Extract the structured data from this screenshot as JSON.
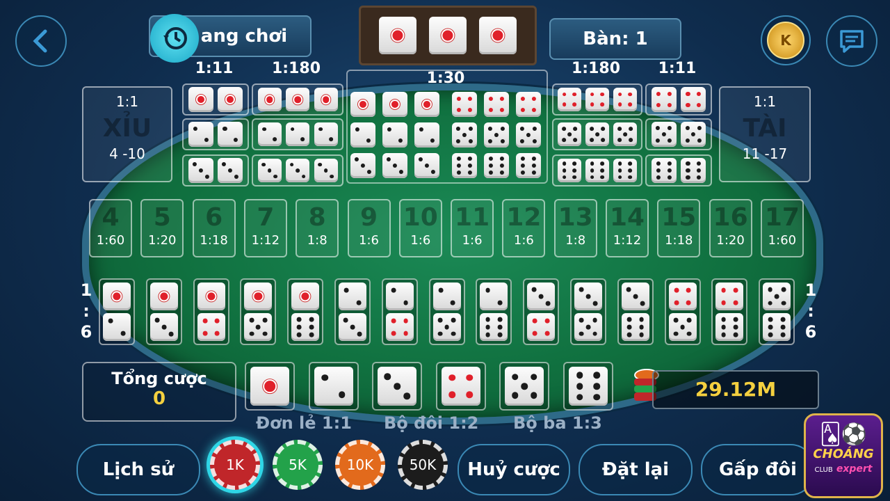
{
  "header": {
    "history_label": "ang chơi",
    "table_label": "Bàn: 1"
  },
  "rolled_dice": [
    1,
    1,
    1
  ],
  "triple_rows": {
    "left_pair_ratio": "1:11",
    "left_triple_ratio": "1:180",
    "any_triple_ratio": "1:30",
    "right_triple_ratio": "1:180",
    "right_pair_ratio": "1:11"
  },
  "small": {
    "ratio": "1:1",
    "name": "XỈU",
    "range": "4 -10"
  },
  "big": {
    "ratio": "1:1",
    "name": "TÀI",
    "range": "11 -17"
  },
  "sums": [
    {
      "n": "4",
      "p": "1:60"
    },
    {
      "n": "5",
      "p": "1:20"
    },
    {
      "n": "6",
      "p": "1:18"
    },
    {
      "n": "7",
      "p": "1:12"
    },
    {
      "n": "8",
      "p": "1:8"
    },
    {
      "n": "9",
      "p": "1:6"
    },
    {
      "n": "10",
      "p": "1:6"
    },
    {
      "n": "11",
      "p": "1:6"
    },
    {
      "n": "12",
      "p": "1:6"
    },
    {
      "n": "13",
      "p": "1:8"
    },
    {
      "n": "14",
      "p": "1:12"
    },
    {
      "n": "15",
      "p": "1:18"
    },
    {
      "n": "16",
      "p": "1:20"
    },
    {
      "n": "17",
      "p": "1:60"
    }
  ],
  "combo_ratio": {
    "top": "1",
    "mid": ":",
    "bot": "6"
  },
  "combos": [
    [
      1,
      2
    ],
    [
      1,
      3
    ],
    [
      1,
      4
    ],
    [
      1,
      5
    ],
    [
      1,
      6
    ],
    [
      2,
      3
    ],
    [
      2,
      4
    ],
    [
      2,
      5
    ],
    [
      2,
      6
    ],
    [
      3,
      4
    ],
    [
      3,
      5
    ],
    [
      3,
      6
    ],
    [
      4,
      5
    ],
    [
      4,
      6
    ],
    [
      5,
      6
    ]
  ],
  "total": {
    "label": "Tổng cược",
    "value": "0"
  },
  "single_dice": [
    1,
    2,
    3,
    4,
    5,
    6
  ],
  "balance": "29.12M",
  "legend": {
    "single": "Đơn lẻ 1:1",
    "double": "Bộ đôi 1:2",
    "triple": "Bộ ba 1:3"
  },
  "buttons": {
    "history": "Lịch sử",
    "cancel": "Huỷ cược",
    "reset": "Đặt lại",
    "double": "Gấp đôi"
  },
  "chips": [
    {
      "label": "1K",
      "color": "#c0262a",
      "selected": true
    },
    {
      "label": "5K",
      "color": "#23a24a",
      "selected": false
    },
    {
      "label": "10K",
      "color": "#e26a1c",
      "selected": false
    },
    {
      "label": "50K",
      "color": "#1c1c1c",
      "selected": false
    }
  ],
  "coin_label": "K",
  "logo": {
    "line1": "CHOÁNG",
    "line2": "CLUB",
    "line3": "expert"
  },
  "colors": {
    "red_pip": "#e0202a",
    "black_pip": "#1b1b1b",
    "gold": "#f4d03f"
  }
}
